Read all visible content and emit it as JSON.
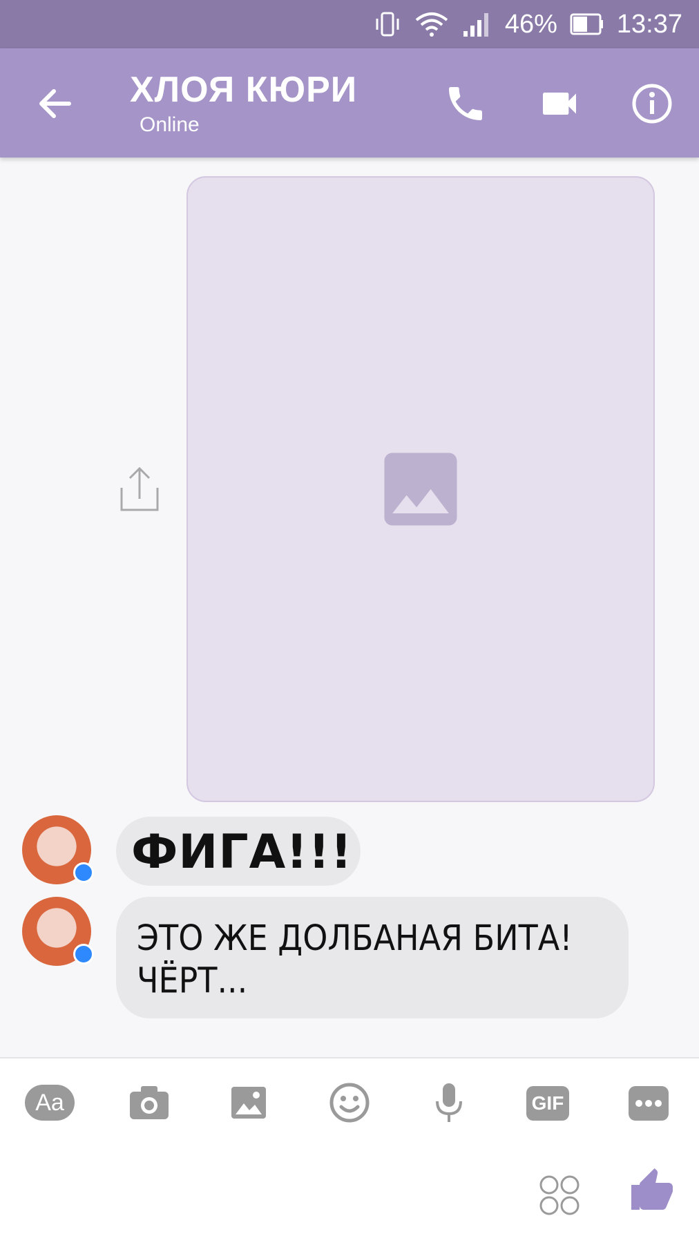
{
  "status_bar": {
    "battery": "46%",
    "time": "13:37",
    "icons": [
      "vibrate-icon",
      "wifi-icon",
      "signal-icon",
      "battery-icon"
    ]
  },
  "header": {
    "contact_name": "ХЛОЯ КЮРИ",
    "status": "Online",
    "icons": [
      "back-arrow-icon",
      "phone-icon",
      "video-camera-icon",
      "info-icon"
    ]
  },
  "conversation": {
    "photo_message": {
      "label": "photo-message"
    },
    "messages": [
      {
        "sender": "contact",
        "text": "ФИГА!!!"
      },
      {
        "sender": "contact",
        "lines": [
          "ЭТО ЖЕ ДОЛБАНАЯ БИТА!",
          "ЧЁРТ..."
        ]
      }
    ]
  },
  "composer": {
    "text_button": "Aa",
    "gif_button": "GIF",
    "icons": [
      "camera-icon",
      "image-icon",
      "emoji-icon",
      "microphone-icon",
      "more-icon",
      "reactions-icon",
      "thumbs-up-icon"
    ]
  },
  "colors": {
    "status_bar": "#8a7aa8",
    "header": "#a494c8",
    "accent": "#9d8dc8",
    "bubble": "#e8e8ea",
    "toolbar_icon": "#9a9a9a"
  }
}
